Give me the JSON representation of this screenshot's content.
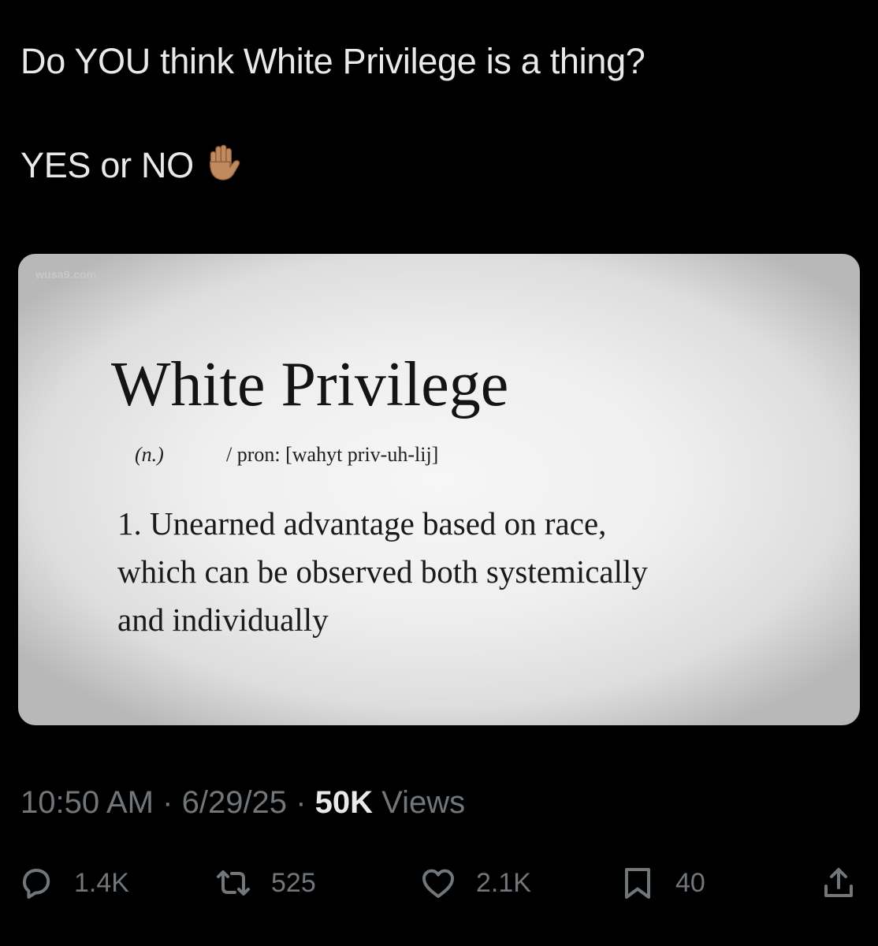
{
  "tweet": {
    "line1": "Do YOU think White Privilege is a thing?",
    "line2": "YES or NO",
    "emoji": "raised-hand-medium-skin-tone"
  },
  "media": {
    "watermark": "wusa9.com",
    "title": "White Privilege",
    "part_of_speech": "(n.)",
    "pronunciation": "/ pron: [wahyt priv-uh-lij]",
    "definition_lines": [
      "1. Unearned advantage based on race,",
      "which can be observed both systemically",
      "and individually"
    ]
  },
  "meta": {
    "time": "10:50 AM",
    "separator": "·",
    "date": "6/29/25",
    "views_count": "50K",
    "views_label": "Views"
  },
  "actions": {
    "replies": "1.4K",
    "reposts": "525",
    "likes": "2.1K",
    "bookmarks": "40"
  },
  "colors": {
    "background": "#000000",
    "primary_text": "#e7e9ea",
    "secondary_text": "#71767b"
  },
  "icons": [
    "hand-icon",
    "reply-icon",
    "retweet-icon",
    "like-icon",
    "bookmark-icon",
    "share-icon"
  ]
}
